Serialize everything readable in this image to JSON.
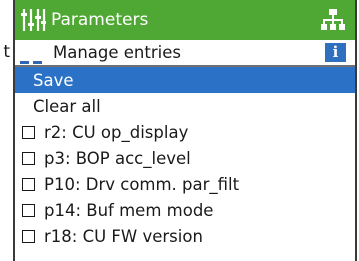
{
  "stray_char": "t",
  "header": {
    "title": "Parameters",
    "icon": "sliders-icon",
    "right_icon": "tree-icon"
  },
  "submenu": {
    "label": "Manage entries",
    "info_icon_text": "i"
  },
  "actions": [
    {
      "label": "Save",
      "selected": true
    },
    {
      "label": "Clear all",
      "selected": false
    }
  ],
  "params": [
    {
      "label": "r2: CU op_display",
      "checked": false
    },
    {
      "label": "p3: BOP acc_level",
      "checked": false
    },
    {
      "label": "P10: Drv comm. par_filt",
      "checked": false
    },
    {
      "label": "p14: Buf mem mode",
      "checked": false
    },
    {
      "label": "r18: CU FW version",
      "checked": false
    }
  ],
  "colors": {
    "header_bg": "#4fa833",
    "selection_bg": "#2b72c6",
    "info_bg": "#2e6fc0"
  }
}
